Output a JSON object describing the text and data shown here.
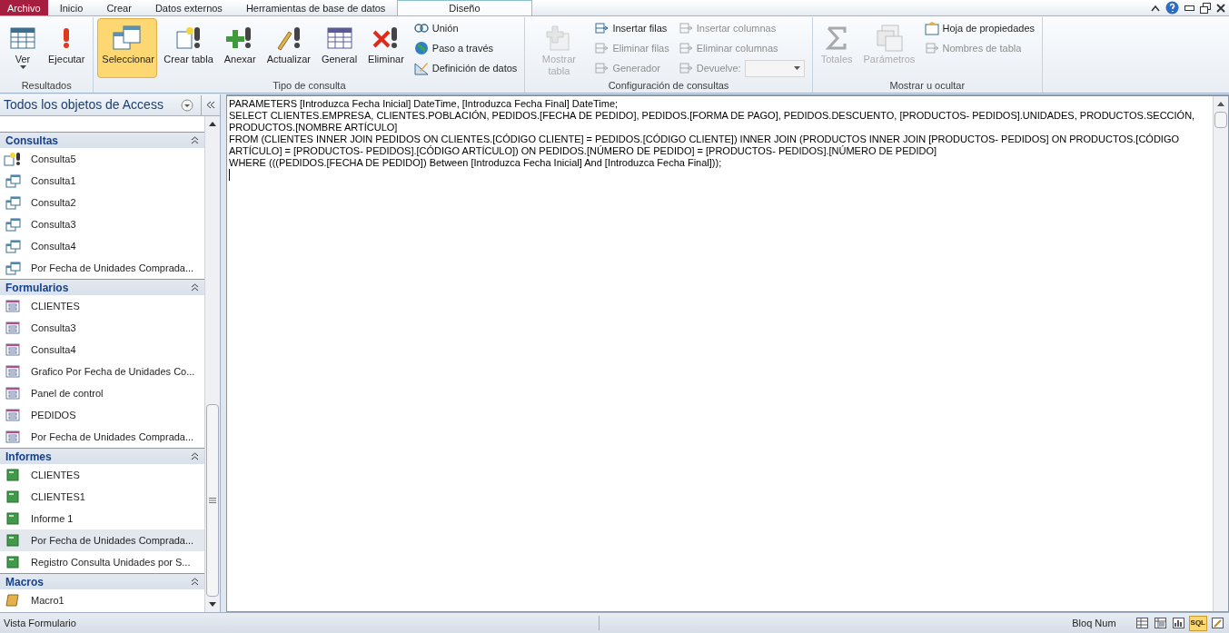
{
  "tabs": [
    {
      "label": "Archivo",
      "kind": "file",
      "selected": false
    },
    {
      "label": "Inicio",
      "kind": "tab",
      "selected": false
    },
    {
      "label": "Crear",
      "kind": "tab",
      "selected": false
    },
    {
      "label": "Datos externos",
      "kind": "tab",
      "selected": false
    },
    {
      "label": "Herramientas de base de datos",
      "kind": "tab",
      "selected": false
    },
    {
      "label": "Diseño",
      "kind": "tab",
      "selected": true
    }
  ],
  "ribbon_groups": [
    {
      "title": "Resultados",
      "items": [
        {
          "kind": "large",
          "label": "Ver",
          "dropdown": true,
          "disabled": false,
          "selected": false
        },
        {
          "kind": "large",
          "label": "Ejecutar",
          "disabled": false,
          "selected": false
        }
      ]
    },
    {
      "title": "Tipo de consulta",
      "items": [
        {
          "kind": "large",
          "label": "Seleccionar",
          "disabled": false,
          "selected": true
        },
        {
          "kind": "large",
          "label": "Crear tabla",
          "disabled": false,
          "selected": false
        },
        {
          "kind": "large",
          "label": "Anexar",
          "disabled": false,
          "selected": false
        },
        {
          "kind": "large",
          "label": "Actualizar",
          "disabled": false,
          "selected": false
        },
        {
          "kind": "large",
          "label": "General",
          "disabled": false,
          "selected": false
        },
        {
          "kind": "large",
          "label": "Eliminar",
          "disabled": false,
          "selected": false
        },
        {
          "kind": "small",
          "label": "Unión",
          "disabled": false
        },
        {
          "kind": "small",
          "label": "Paso a través",
          "disabled": false
        },
        {
          "kind": "small",
          "label": "Definición de datos",
          "disabled": false
        }
      ]
    },
    {
      "title": "Configuración de consultas",
      "items": [
        {
          "kind": "large",
          "label": "Mostrar tabla",
          "disabled": true,
          "selected": false
        },
        {
          "kind": "small",
          "label": "Insertar filas",
          "disabled": false
        },
        {
          "kind": "small",
          "label": "Eliminar filas",
          "disabled": true
        },
        {
          "kind": "small",
          "label": "Generador",
          "disabled": true
        },
        {
          "kind": "small",
          "label": "Insertar columnas",
          "disabled": true
        },
        {
          "kind": "small",
          "label": "Eliminar columnas",
          "disabled": true
        },
        {
          "kind": "combo",
          "label": "Devuelve:",
          "disabled": true
        }
      ]
    },
    {
      "title": "Mostrar u ocultar",
      "items": [
        {
          "kind": "large",
          "label": "Totales",
          "disabled": true,
          "selected": false
        },
        {
          "kind": "large",
          "label": "Parámetros",
          "disabled": true,
          "selected": false
        },
        {
          "kind": "small",
          "label": "Hoja de propiedades",
          "disabled": false
        },
        {
          "kind": "small",
          "label": "Nombres de tabla",
          "disabled": true
        }
      ]
    }
  ],
  "navigation": {
    "title": "Todos los objetos de Access",
    "groups": [
      {
        "title": "Consultas",
        "expanded": true,
        "items": [
          {
            "label": "Consulta5",
            "kind": "query-new",
            "selected": false
          },
          {
            "label": "Consulta1",
            "kind": "query",
            "selected": false
          },
          {
            "label": "Consulta2",
            "kind": "query",
            "selected": false
          },
          {
            "label": "Consulta3",
            "kind": "query",
            "selected": false
          },
          {
            "label": "Consulta4",
            "kind": "query",
            "selected": false
          },
          {
            "label": "Por Fecha de Unidades Comprada...",
            "kind": "query",
            "selected": false
          }
        ]
      },
      {
        "title": "Formularios",
        "expanded": true,
        "items": [
          {
            "label": "CLIENTES",
            "kind": "form",
            "selected": false
          },
          {
            "label": "Consulta3",
            "kind": "form",
            "selected": false
          },
          {
            "label": "Consulta4",
            "kind": "form",
            "selected": false
          },
          {
            "label": "Grafico Por Fecha de Unidades Co...",
            "kind": "form",
            "selected": false
          },
          {
            "label": "Panel de control",
            "kind": "form",
            "selected": false
          },
          {
            "label": "PEDIDOS",
            "kind": "form",
            "selected": false
          },
          {
            "label": "Por Fecha de Unidades Comprada...",
            "kind": "form",
            "selected": false
          }
        ]
      },
      {
        "title": "Informes",
        "expanded": true,
        "items": [
          {
            "label": "CLIENTES",
            "kind": "report",
            "selected": false
          },
          {
            "label": "CLIENTES1",
            "kind": "report",
            "selected": false
          },
          {
            "label": "Informe 1",
            "kind": "report",
            "selected": false
          },
          {
            "label": "Por Fecha de Unidades Comprada...",
            "kind": "report",
            "selected": true
          },
          {
            "label": "Registro Consulta Unidades por S...",
            "kind": "report",
            "selected": false
          }
        ]
      },
      {
        "title": "Macros",
        "expanded": true,
        "items": [
          {
            "label": "Macro1",
            "kind": "macro",
            "selected": false
          }
        ]
      }
    ]
  },
  "sql_lines": [
    "PARAMETERS [Introduzca Fecha Inicial] DateTime, [Introduzca Fecha Final] DateTime;",
    "SELECT CLIENTES.EMPRESA, CLIENTES.POBLACIÓN, PEDIDOS.[FECHA DE PEDIDO], PEDIDOS.[FORMA DE PAGO], PEDIDOS.DESCUENTO, [PRODUCTOS- PEDIDOS].UNIDADES, PRODUCTOS.SECCIÓN, PRODUCTOS.[NOMBRE ARTÍCULO]",
    "FROM (CLIENTES INNER JOIN PEDIDOS ON CLIENTES.[CÓDIGO CLIENTE] = PEDIDOS.[CÓDIGO CLIENTE]) INNER JOIN (PRODUCTOS INNER JOIN [PRODUCTOS- PEDIDOS] ON PRODUCTOS.[CÓDIGO ARTÍCULO] = [PRODUCTOS- PEDIDOS].[CÓDIGO ARTÍCULO]) ON PEDIDOS.[NÚMERO DE PEDIDO] = [PRODUCTOS- PEDIDOS].[NÚMERO DE PEDIDO]",
    "WHERE (((PEDIDOS.[FECHA DE PEDIDO]) Between [Introduzca Fecha Inicial] And [Introduzca Fecha Final]));"
  ],
  "status_bar": {
    "text": "Vista Formulario",
    "indicator": "Bloq Num",
    "views": [
      {
        "kind": "datasheet",
        "selected": false
      },
      {
        "kind": "pivot-table",
        "selected": false
      },
      {
        "kind": "pivot-chart",
        "selected": false
      },
      {
        "kind": "sql",
        "label": "SQL",
        "selected": true
      },
      {
        "kind": "design",
        "selected": false
      }
    ]
  }
}
